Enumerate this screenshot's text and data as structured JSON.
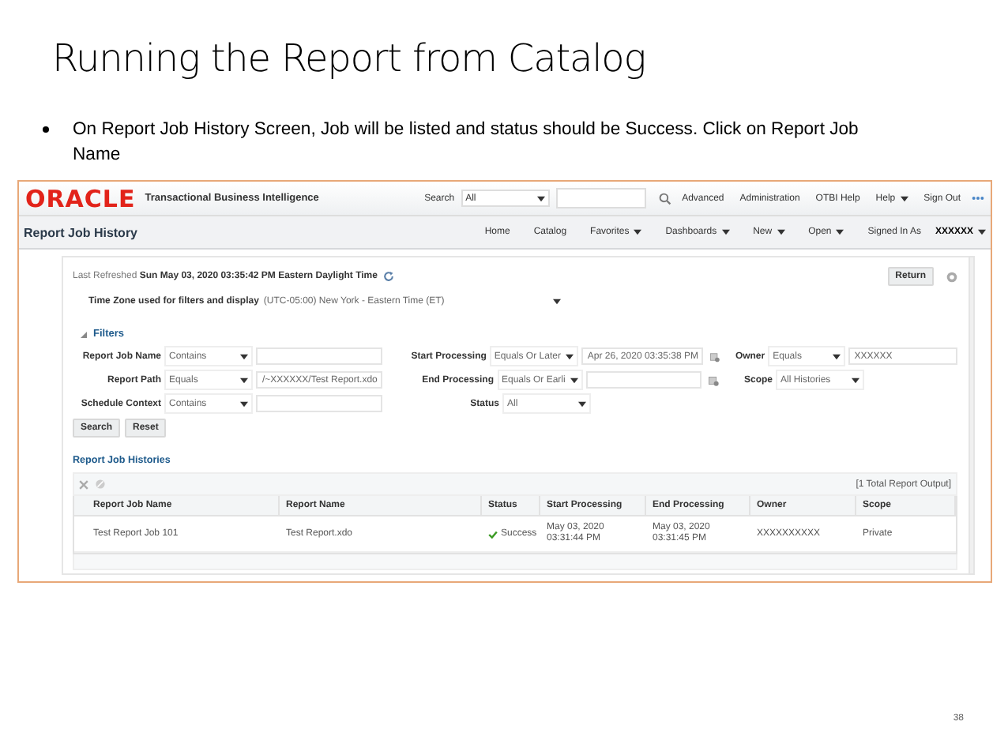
{
  "slide": {
    "title": "Running the Report from Catalog",
    "bullet": "On Report Job History Screen, Job will be listed and status should be Success. Click on Report Job Name",
    "page_number": "38"
  },
  "app": {
    "logo": "ORACLE",
    "product": "Transactional Business Intelligence",
    "search_label": "Search",
    "search_scope": "All",
    "global_links": [
      {
        "label": "Advanced",
        "dropdown": false
      },
      {
        "label": "Administration",
        "dropdown": false
      },
      {
        "label": "OTBI Help",
        "dropdown": false
      },
      {
        "label": "Help",
        "dropdown": true
      },
      {
        "label": "Sign Out",
        "dropdown": false
      }
    ],
    "page_title": "Report Job History",
    "nav": [
      {
        "label": "Home",
        "dropdown": false
      },
      {
        "label": "Catalog",
        "dropdown": false
      },
      {
        "label": "Favorites",
        "dropdown": true
      },
      {
        "label": "Dashboards",
        "dropdown": true
      },
      {
        "label": "New",
        "dropdown": true
      },
      {
        "label": "Open",
        "dropdown": true
      }
    ],
    "signed_in_label": "Signed In As",
    "user": "XXXXXX",
    "last_refreshed_label": "Last Refreshed",
    "last_refreshed_value": "Sun May 03, 2020 03:35:42 PM Eastern Daylight Time",
    "return_button": "Return",
    "timezone_label": "Time Zone used for filters and display",
    "timezone_value": "(UTC-05:00) New York - Eastern Time (ET)",
    "filters": {
      "title": "Filters",
      "expanded": true,
      "columns": [
        [
          {
            "label": "Report Job Name",
            "operator": "Contains",
            "kind": "text"
          },
          {
            "label": "Report Path",
            "operator": "Equals",
            "kind": "text",
            "value": "/~XXXXXX/Test Report.xdo"
          },
          {
            "label": "Schedule Context",
            "operator": "Contains",
            "kind": "text"
          }
        ],
        [
          {
            "label": "Start Processing",
            "operator": "Equals Or Later",
            "kind": "date",
            "value": "Apr 26, 2020 03:35:38 PM"
          },
          {
            "label": "End Processing",
            "operator": "Equals Or Earli",
            "kind": "date"
          },
          {
            "label": "Status",
            "operator": "All",
            "kind": "select"
          }
        ],
        [
          {
            "label": "Owner",
            "operator": "Equals",
            "kind": "text",
            "value": "XXXXXX"
          },
          {
            "label": "Scope",
            "operator": "All Histories",
            "kind": "select"
          }
        ]
      ]
    },
    "buttons": [
      "Search",
      "Reset"
    ],
    "histories_title": "Report Job Histories",
    "total": "[1 Total Report Output]",
    "table": {
      "columns": [
        "Report Job Name",
        "Report Name",
        "Status",
        "Start Processing",
        "End Processing",
        "Owner",
        "Scope"
      ],
      "rows": [
        {
          "job": "Test Report Job 101",
          "report": "Test Report.xdo",
          "status": "Success",
          "succeeded": true,
          "start": [
            "May 03, 2020",
            "03:31:44 PM"
          ],
          "end": [
            "May 03, 2020",
            "03:31:45 PM"
          ],
          "owner": "XXXXXXXXXX",
          "scope": "Private"
        }
      ]
    }
  }
}
